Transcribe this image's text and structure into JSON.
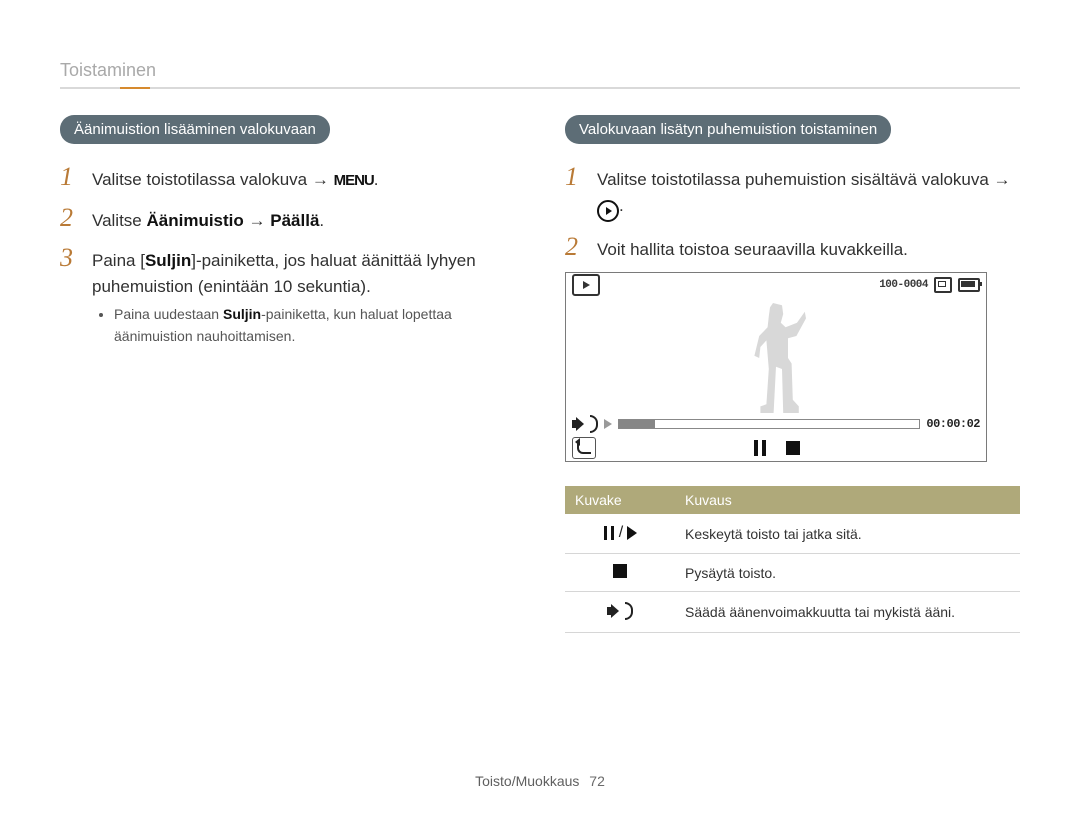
{
  "section_title": "Toistaminen",
  "left": {
    "pill": "Äänimuistion lisääminen valokuvaan",
    "steps": {
      "s1_pre": "Valitse toistotilassa valokuva ",
      "arrow": "→",
      "menu_word": "MENU",
      "s1_post": ".",
      "s2_pre": "Valitse ",
      "s2_b1": "Äänimuistio",
      "s2_mid": " → ",
      "s2_b2": "Päällä",
      "s2_post": ".",
      "s3_pre": "Paina [",
      "s3_b": "Suljin",
      "s3_post": "]-painiketta, jos haluat äänittää lyhyen puhemuistion (enintään 10 sekuntia).",
      "bullet_pre": "Paina uudestaan ",
      "bullet_b": "Suljin",
      "bullet_post": "-painiketta, kun haluat lopettaa äänimuistion nauhoittamisen."
    }
  },
  "right": {
    "pill": "Valokuvaan lisätyn puhemuistion toistaminen",
    "steps": {
      "s1": "Valitse toistotilassa puhemuistion sisältävä valokuva →",
      "s2": "Voit hallita toistoa seuraavilla kuvakkeilla."
    },
    "screen": {
      "counter": "100-0004",
      "time": "00:00:02"
    },
    "table": {
      "h1": "Kuvake",
      "h2": "Kuvaus",
      "r1": "Keskeytä toisto tai jatka sitä.",
      "r2": "Pysäytä toisto.",
      "r3": "Säädä äänenvoimakkuutta tai mykistä ääni."
    }
  },
  "footer": {
    "label": "Toisto/Muokkaus",
    "page": "72"
  }
}
